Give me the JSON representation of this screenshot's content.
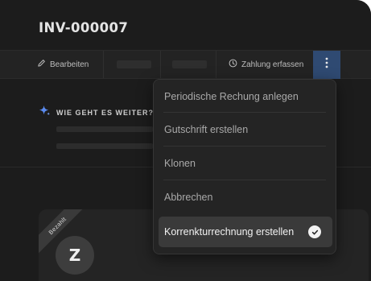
{
  "invoice": {
    "number": "INV-000007"
  },
  "toolbar": {
    "edit_label": "Bearbeiten",
    "payment_label": "Zahlung erfassen",
    "more_icon": "more-vertical-icon",
    "active_color": "#2f4a72"
  },
  "next_steps": {
    "label": "WIE GEHT ES WEITER?"
  },
  "menu": {
    "items": [
      {
        "label": "Periodische Rechung anlegen"
      },
      {
        "label": "Gutschrift erstellen"
      },
      {
        "label": "Klonen"
      },
      {
        "label": "Abbrechen"
      },
      {
        "label": "Korrenkturrechnung erstellen",
        "selected": true
      }
    ]
  },
  "card": {
    "status_ribbon": "Bezahlt",
    "avatar_letter": "Z"
  }
}
